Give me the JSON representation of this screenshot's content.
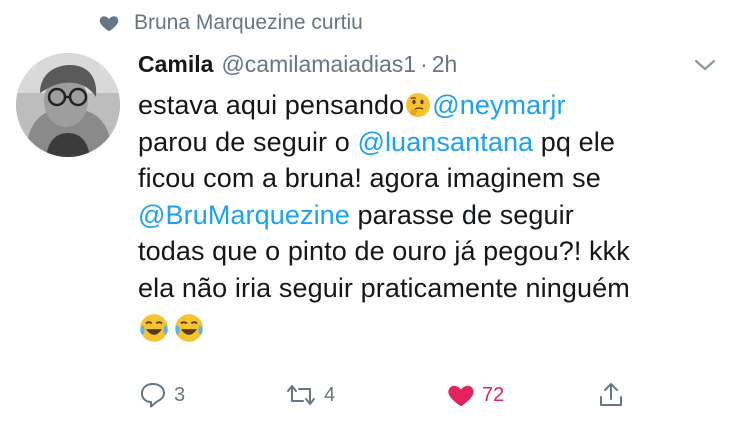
{
  "social_context": {
    "icon": "heart-icon",
    "text": "Bruna Marquezine curtiu"
  },
  "tweet": {
    "author_name": "Camila",
    "author_handle": "@camilamaiadias1",
    "separator": "·",
    "time": "2h",
    "lines": [
      [
        "estava aqui pensando",
        "thinking-face-emoji",
        "@neymarjr"
      ],
      [
        "parou de seguir o ",
        "@luansantana",
        " pq ele"
      ],
      [
        "ficou com a bruna! agora imaginem se"
      ],
      [
        "@BruMarquezine",
        " parasse de seguir"
      ],
      [
        "todas que o pinto de ouro já pegou?! kkk"
      ],
      [
        "ela não iria seguir praticamente ninguém"
      ]
    ],
    "line1_text": "estava aqui pensando",
    "line1_mention": "@neymarjr",
    "line2_pre": "parou de seguir o ",
    "line2_mention": "@luansantana",
    "line2_post": " pq ele",
    "line3": "ficou com a bruna! agora imaginem se",
    "line4_mention": "@BruMarquezine",
    "line4_post": " parasse de seguir",
    "line5": "todas que o pinto de ouro já pegou?! kkk",
    "line6": "ela não iria seguir praticamente ninguém",
    "trailing_emojis": [
      "laughing-tears-emoji",
      "laughing-tears-emoji"
    ]
  },
  "actions": {
    "reply_count": "3",
    "retweet_count": "4",
    "like_count": "72",
    "like_color": "#e0245e",
    "mention_color": "#1da1f2",
    "icons": [
      "reply-icon",
      "retweet-icon",
      "heart-icon",
      "share-icon"
    ]
  }
}
